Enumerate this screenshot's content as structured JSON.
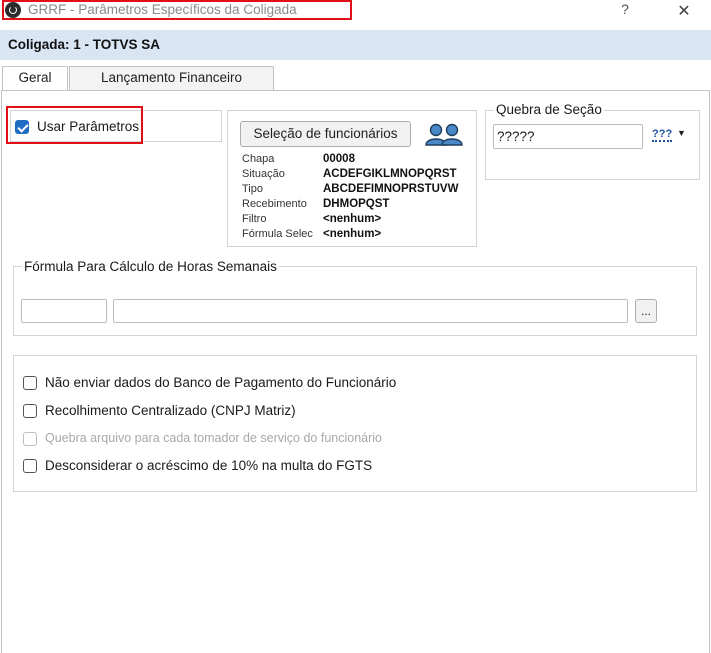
{
  "window": {
    "title": "GRRF - Parâmetros Específicos da Coligada",
    "help_label": "?",
    "close_label": "✕"
  },
  "header": {
    "coligada": "Coligada: 1 - TOTVS SA"
  },
  "tabs": [
    {
      "label": "Geral",
      "active": true
    },
    {
      "label": "Lançamento Financeiro",
      "active": false
    }
  ],
  "usar_parametros": {
    "label": "Usar Parâmetros",
    "checked": true
  },
  "selecao": {
    "button_label": "Seleção de funcionários",
    "icon": "users-icon",
    "fields": [
      {
        "key": "Chapa",
        "value": "00008"
      },
      {
        "key": "Situação",
        "value": "ACDEFGIKLMNOPQRST"
      },
      {
        "key": "Tipo",
        "value": "ABCDEFIMNOPRSTUVW"
      },
      {
        "key": "Recebimento",
        "value": "DHMOPQST"
      },
      {
        "key": "Filtro",
        "value": "<nenhum>"
      },
      {
        "key": "Fórmula Selec",
        "value": "<nenhum>"
      }
    ]
  },
  "quebra_secao": {
    "legend": "Quebra de Seção",
    "value": "?????",
    "picker_label": "???"
  },
  "formula": {
    "legend": "Fórmula Para Cálculo de Horas Semanais",
    "code_value": "",
    "description_value": "",
    "browse_label": "..."
  },
  "options": [
    {
      "label": "Não enviar dados do Banco de Pagamento do Funcionário",
      "checked": false,
      "enabled": true
    },
    {
      "label": "Recolhimento Centralizado (CNPJ Matriz)",
      "checked": false,
      "enabled": true
    },
    {
      "label": "Quebra arquivo para cada tomador de serviço do funcionário",
      "checked": false,
      "enabled": false
    },
    {
      "label": "Desconsiderar o acréscimo de 10% na multa do FGTS",
      "checked": false,
      "enabled": true
    }
  ],
  "colors": {
    "highlight": "#e0101a",
    "header_bg": "#d9e5f3",
    "accent": "#1e6fc4"
  }
}
